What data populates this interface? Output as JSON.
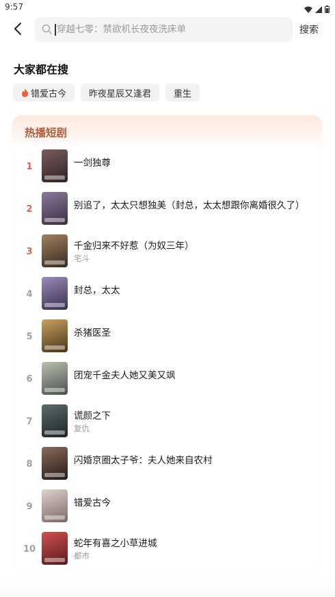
{
  "status_bar": {
    "time": "9:57"
  },
  "search": {
    "placeholder": "穿越七零：禁欲机长夜夜洗床单",
    "button_label": "搜索"
  },
  "popular": {
    "title": "大家都在搜",
    "chips": [
      "错爱古今",
      "昨夜星辰又逢君",
      "重生"
    ]
  },
  "hot_dramas": {
    "title": "热播短剧",
    "items": [
      {
        "rank": "1",
        "title": "一剑独尊",
        "tag": ""
      },
      {
        "rank": "2",
        "title": "别追了，太太只想独美（封总，太太想跟你离婚很久了）",
        "tag": ""
      },
      {
        "rank": "3",
        "title": "千金归来不好惹（为奴三年）",
        "tag": "宅斗"
      },
      {
        "rank": "4",
        "title": "封总，太太",
        "tag": ""
      },
      {
        "rank": "5",
        "title": "杀猪医圣",
        "tag": ""
      },
      {
        "rank": "6",
        "title": "团宠千金夫人她又美又飒",
        "tag": ""
      },
      {
        "rank": "7",
        "title": "谎颜之下",
        "tag": "复仇"
      },
      {
        "rank": "8",
        "title": "闪婚京圈太子爷：夫人她来自农村",
        "tag": ""
      },
      {
        "rank": "9",
        "title": "错爱古今",
        "tag": ""
      },
      {
        "rank": "10",
        "title": "蛇年有喜之小草进城",
        "tag": "都市"
      }
    ]
  },
  "colors": {
    "accent": "#e2624a",
    "panel_title": "#b55a3a",
    "poster_tints": [
      "#4a3a3a",
      "#5a4a6a",
      "#6a4a3a",
      "#5a4a7a",
      "#8a6a3a",
      "#6a7a6a",
      "#3a4a4a",
      "#5a3a3a",
      "#9a8a8a",
      "#a04040"
    ]
  },
  "icons": {
    "back": "chevron-left-icon",
    "search": "search-icon",
    "flame": "flame-icon",
    "wifi": "wifi-icon",
    "signal": "signal-icon",
    "battery": "battery-icon"
  }
}
